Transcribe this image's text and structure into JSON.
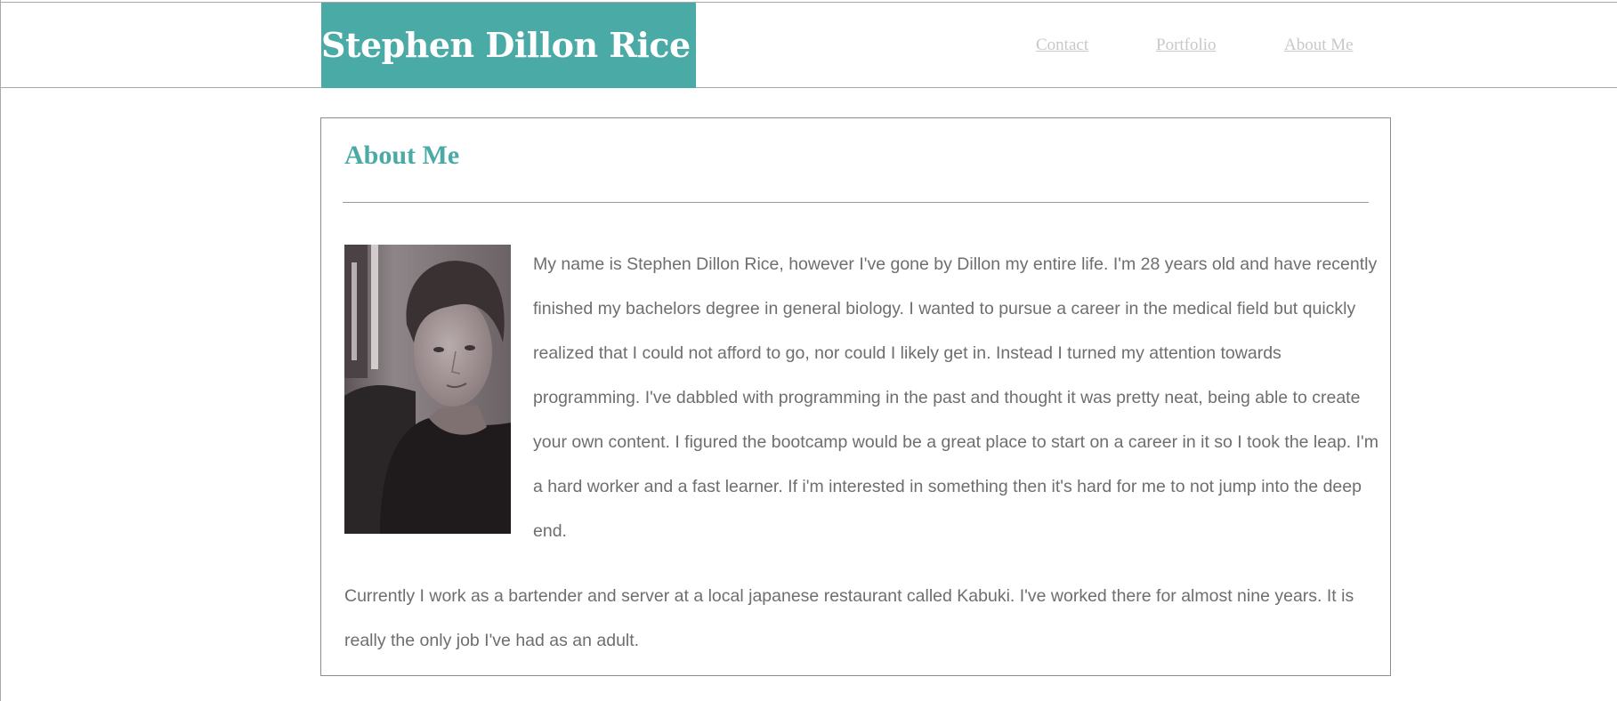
{
  "header": {
    "site_title": "Stephen Dillon Rice",
    "nav": [
      {
        "label": "Contact"
      },
      {
        "label": "Portfolio"
      },
      {
        "label": "About Me"
      }
    ]
  },
  "about": {
    "heading": "About Me",
    "photo_alt": "Portrait photo of Stephen Dillon Rice",
    "paragraph_1": "My name is Stephen Dillon Rice, however I've gone by Dillon my entire life. I'm 28 years old and have recently finished my bachelors degree in general biology. I wanted to pursue a career in the medical field but quickly realized that I could not afford to go, nor could I likely get in. Instead I turned my attention towards programming. I've dabbled with programming in the past and thought it was pretty neat, being able to create your own content. I figured the bootcamp would be a great place to start on a career in it so I took the leap. I'm a hard worker and a fast learner. If i'm interested in something then it's hard for me to not jump into the deep end.",
    "paragraph_2": "Currently I work as a bartender and server at a local japanese restaurant called Kabuki. I've worked there for almost nine years. It is really the only job I've had as an adult."
  },
  "colors": {
    "accent": "#4aaaa5",
    "nav_link": "#c8c8c8",
    "body_text": "#6e6e6e",
    "border": "#8c8c8c"
  }
}
